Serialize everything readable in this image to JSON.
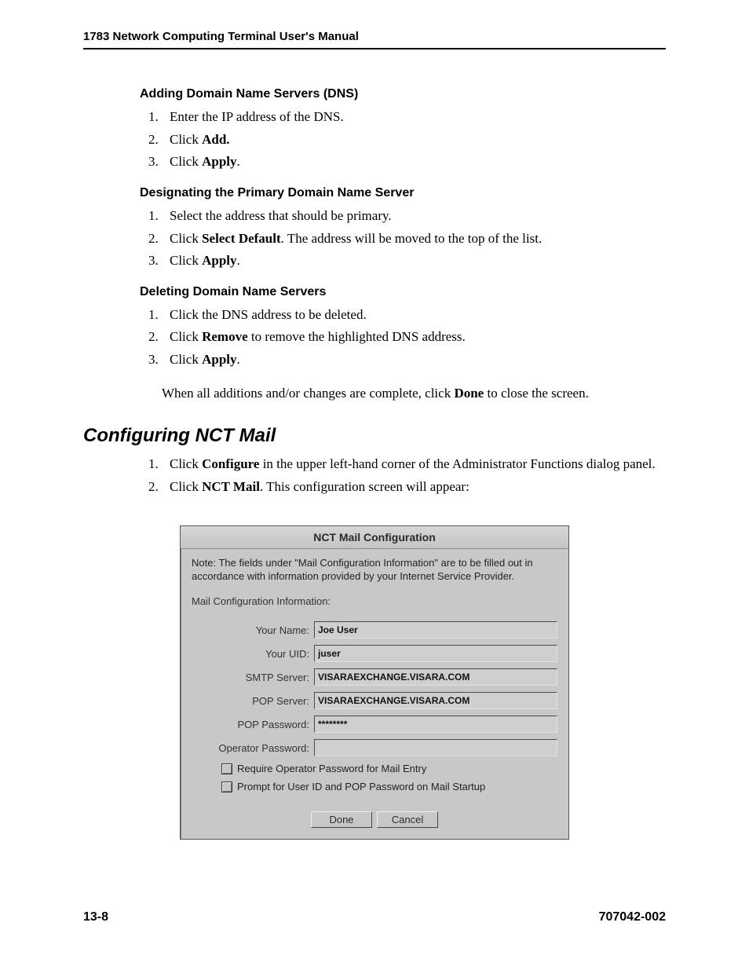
{
  "header": {
    "title": "1783 Network Computing Terminal User's Manual"
  },
  "dns_add": {
    "heading": "Adding Domain Name Servers (DNS)",
    "steps": {
      "s1": "Enter the IP address of the DNS.",
      "s2_pre": "Click ",
      "s2_bold": "Add.",
      "s3_pre": "Click ",
      "s3_bold": "Apply",
      "s3_post": "."
    }
  },
  "dns_primary": {
    "heading": "Designating the Primary Domain Name Server",
    "steps": {
      "s1": "Select the address that should be primary.",
      "s2_pre": "Click ",
      "s2_bold": "Select Default",
      "s2_post": ". The address will be moved to the top of the list.",
      "s3_pre": "Click ",
      "s3_bold": "Apply",
      "s3_post": "."
    }
  },
  "dns_delete": {
    "heading": "Deleting Domain Name Servers",
    "steps": {
      "s1": "Click the DNS address to be deleted.",
      "s2_pre": "Click ",
      "s2_bold": "Remove",
      "s2_post": " to remove the highlighted DNS address.",
      "s3_pre": "Click ",
      "s3_bold": "Apply",
      "s3_post": "."
    },
    "closing_pre": "When all additions and/or changes are complete, click ",
    "closing_bold": "Done",
    "closing_post": " to close the screen."
  },
  "mail_section": {
    "heading": "Configuring NCT Mail",
    "steps": {
      "s1_pre": "Click ",
      "s1_bold": "Configure",
      "s1_post": " in the upper left-hand corner of the Administrator Functions dialog panel.",
      "s2_pre": "Click ",
      "s2_bold": "NCT Mail",
      "s2_post": ". This configuration screen will appear:"
    }
  },
  "dialog": {
    "title": "NCT Mail Configuration",
    "note": "Note: The fields under \"Mail Configuration Information\" are to be filled out in accordance with information provided by your Internet Service Provider.",
    "section_label": "Mail Configuration Information:",
    "labels": {
      "name": "Your Name:",
      "uid": "Your UID:",
      "smtp": "SMTP Server:",
      "pop": "POP Server:",
      "poppw": "POP Password:",
      "oppw": "Operator Password:"
    },
    "values": {
      "name": "Joe User",
      "uid": "juser",
      "smtp": "VISARAEXCHANGE.VISARA.COM",
      "pop": "VISARAEXCHANGE.VISARA.COM",
      "poppw": "********",
      "oppw": ""
    },
    "checks": {
      "c1": "Require Operator Password for Mail Entry",
      "c2": "Prompt for User ID and POP Password on Mail Startup"
    },
    "buttons": {
      "done": "Done",
      "cancel": "Cancel"
    }
  },
  "footer": {
    "left": "13-8",
    "right": "707042-002"
  }
}
